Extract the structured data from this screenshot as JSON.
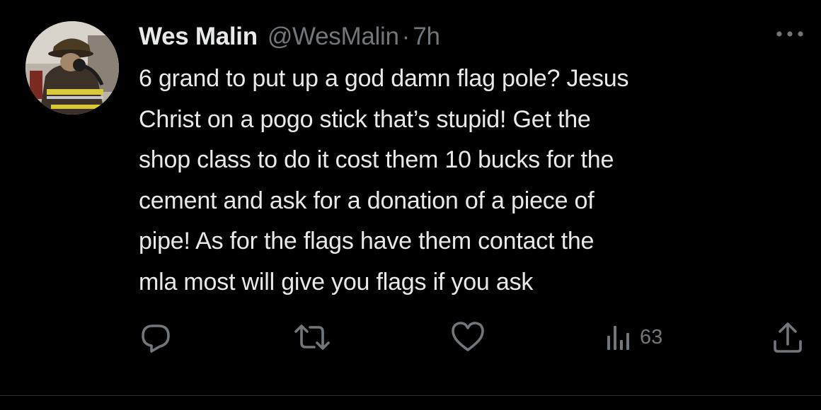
{
  "tweet": {
    "display_name": "Wes Malin",
    "handle": "@WesMalin",
    "separator": "·",
    "time": "7h",
    "text": "6 grand to put up a god damn flag pole? Jesus\nChrist on a pogo stick that’s stupid! Get the\nshop class to do it cost them 10 bucks for the\ncement and ask for a donation of a piece of\npipe! As for the flags have them contact the\nmla most will give you flags if you ask"
  },
  "actions": {
    "views": "63"
  },
  "icons": {
    "avatar": "firefighter-avatar",
    "more": "more-horizontal-icon",
    "reply": "reply-icon",
    "retweet": "retweet-icon",
    "like": "heart-icon",
    "views": "views-chart-icon",
    "share": "share-icon"
  },
  "colors": {
    "background": "#000000",
    "primary_text": "#e7e9ea",
    "secondary_text": "#71767b",
    "divider": "#2f3336"
  }
}
